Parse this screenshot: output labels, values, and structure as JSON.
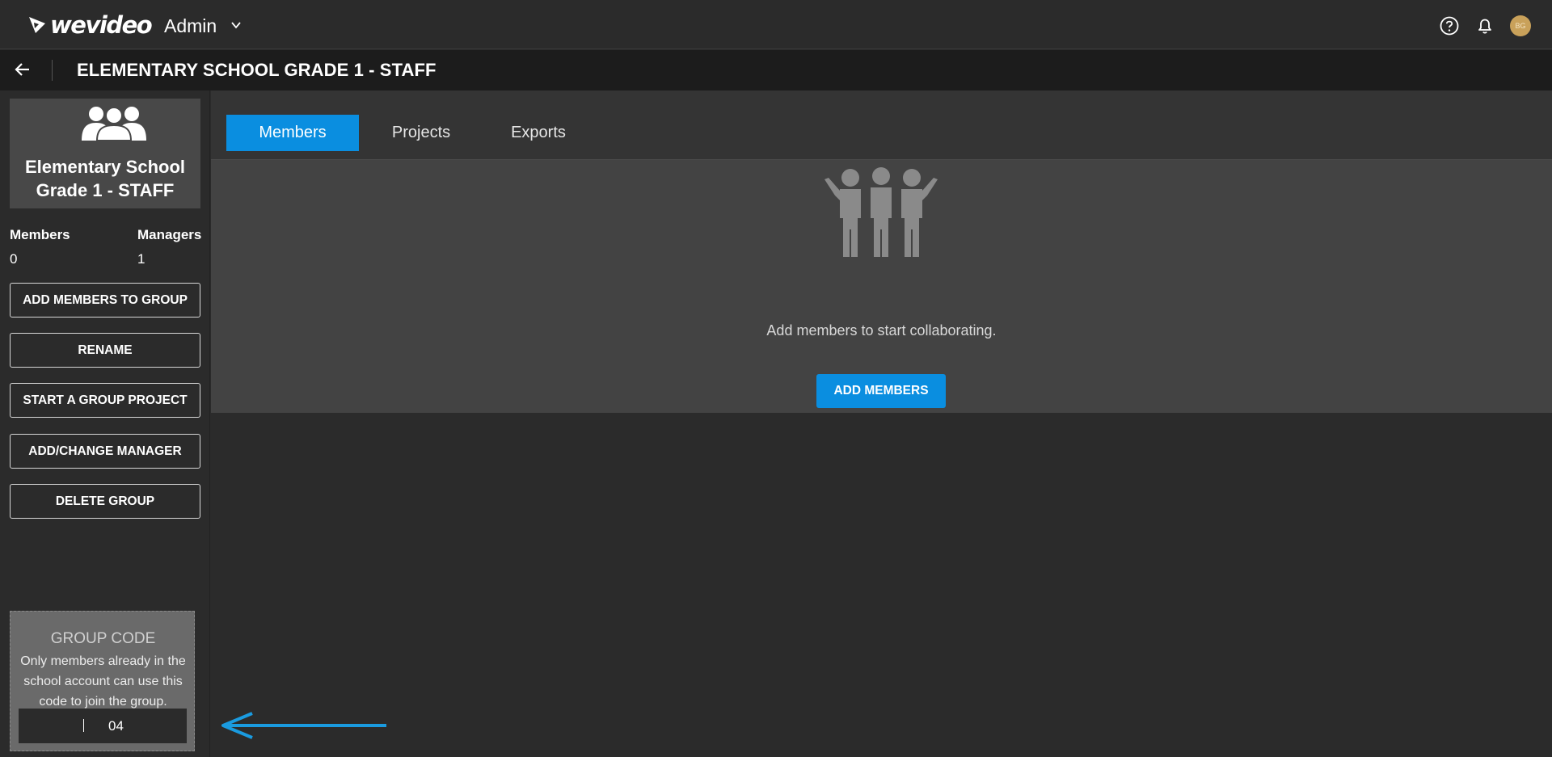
{
  "app": {
    "brand": "wevideo",
    "section": "Admin"
  },
  "topbar": {
    "help_icon": "question-circle-icon",
    "notifications_icon": "bell-icon",
    "avatar_initials": "BG",
    "avatar_color": "#c9a15a"
  },
  "page": {
    "title": "ELEMENTARY SCHOOL GRADE 1 - STAFF",
    "back_icon": "arrow-left-icon"
  },
  "sidebar": {
    "group_name": "Elementary School Grade 1 - STAFF",
    "stats": {
      "members_label": "Members",
      "members_value": "0",
      "managers_label": "Managers",
      "managers_value": "1"
    },
    "buttons": [
      "ADD MEMBERS TO GROUP",
      "RENAME",
      "START A GROUP PROJECT",
      "ADD/CHANGE MANAGER",
      "DELETE GROUP"
    ],
    "group_code": {
      "title": "GROUP CODE",
      "description": "Only members already in the school account can use this code to join the group.",
      "value": "04"
    }
  },
  "tabs": [
    {
      "label": "Members",
      "active": true
    },
    {
      "label": "Projects",
      "active": false
    },
    {
      "label": "Exports",
      "active": false
    }
  ],
  "empty_state": {
    "message": "Add members to start collaborating.",
    "button": "ADD MEMBERS"
  },
  "colors": {
    "accent": "#0a8ee0",
    "annotation_arrow": "#1a9be0"
  }
}
